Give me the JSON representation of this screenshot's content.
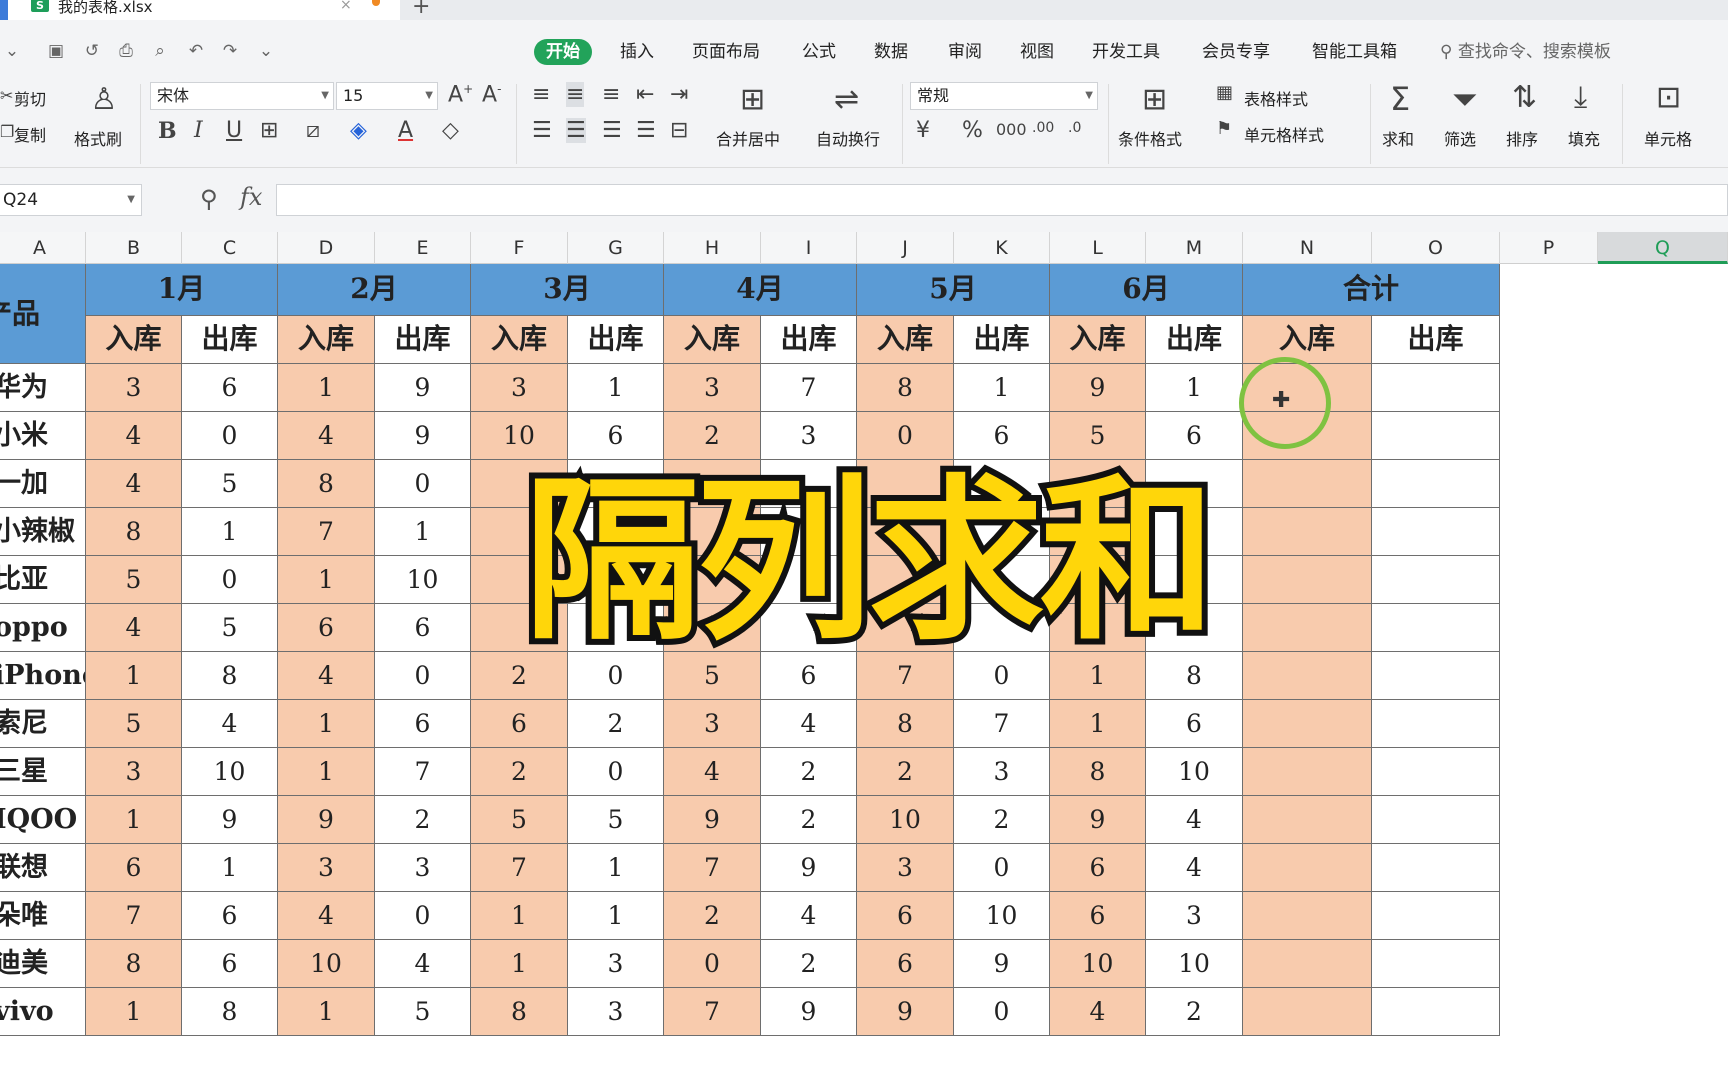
{
  "titlebar": {
    "file_name": "我的表格.xlsx",
    "close": "×",
    "new_tab": "+"
  },
  "menu": {
    "items": [
      "开始",
      "插入",
      "页面布局",
      "公式",
      "数据",
      "审阅",
      "视图",
      "开发工具",
      "会员专享",
      "智能工具箱"
    ],
    "search_placeholder": "查找命令、搜索模板"
  },
  "ribbon": {
    "cut": "剪切",
    "copy": "复制",
    "format_painter": "格式刷",
    "font_name": "宋体",
    "font_size": "15",
    "bold": "B",
    "italic": "I",
    "underline": "U",
    "merge_center": "合并居中",
    "wrap_text": "自动换行",
    "number_format": "常规",
    "conditional_format": "条件格式",
    "table_style": "表格样式",
    "cell_style": "单元格样式",
    "sum": "求和",
    "filter": "筛选",
    "sort": "排序",
    "fill": "填充",
    "cell": "单元格"
  },
  "formula_bar": {
    "cell_ref": "Q24",
    "fx": "fx",
    "value": ""
  },
  "columns": [
    "A",
    "B",
    "C",
    "D",
    "E",
    "F",
    "G",
    "H",
    "I",
    "J",
    "K",
    "L",
    "M",
    "N",
    "O",
    "P",
    "Q"
  ],
  "selected_column": "Q",
  "sheet": {
    "product_header": "产品",
    "months": [
      "1月",
      "2月",
      "3月",
      "4月",
      "5月",
      "6月"
    ],
    "total_header": "合计",
    "in_label": "入库",
    "out_label": "出库",
    "rows": [
      {
        "product": "华为",
        "values": [
          "3",
          "6",
          "1",
          "9",
          "3",
          "1",
          "3",
          "7",
          "8",
          "1",
          "9",
          "1"
        ]
      },
      {
        "product": "小米",
        "values": [
          "4",
          "0",
          "4",
          "9",
          "10",
          "6",
          "2",
          "3",
          "0",
          "6",
          "5",
          "6"
        ]
      },
      {
        "product": "一加",
        "values": [
          "4",
          "5",
          "8",
          "0",
          "",
          "",
          "",
          "",
          "",
          "",
          "",
          ""
        ]
      },
      {
        "product": "小辣椒",
        "values": [
          "8",
          "1",
          "7",
          "1",
          "",
          "",
          "",
          "",
          "",
          "",
          "",
          ""
        ]
      },
      {
        "product": "比亚",
        "values": [
          "5",
          "0",
          "1",
          "10",
          "",
          "",
          "",
          "",
          "",
          "",
          "",
          ""
        ]
      },
      {
        "product": "oppo",
        "values": [
          "4",
          "5",
          "6",
          "6",
          "",
          "",
          "",
          "",
          "",
          "",
          "",
          ""
        ]
      },
      {
        "product": "iPhone",
        "values": [
          "1",
          "8",
          "4",
          "0",
          "2",
          "0",
          "5",
          "6",
          "7",
          "0",
          "1",
          "8"
        ]
      },
      {
        "product": "索尼",
        "values": [
          "5",
          "4",
          "1",
          "6",
          "6",
          "2",
          "3",
          "4",
          "8",
          "7",
          "1",
          "6"
        ]
      },
      {
        "product": "三星",
        "values": [
          "3",
          "10",
          "1",
          "7",
          "2",
          "0",
          "4",
          "2",
          "2",
          "3",
          "8",
          "10"
        ]
      },
      {
        "product": "IQOO",
        "values": [
          "1",
          "9",
          "9",
          "2",
          "5",
          "5",
          "9",
          "2",
          "10",
          "2",
          "9",
          "4"
        ]
      },
      {
        "product": "联想",
        "values": [
          "6",
          "1",
          "3",
          "3",
          "7",
          "1",
          "7",
          "9",
          "3",
          "0",
          "6",
          "4"
        ]
      },
      {
        "product": "朵唯",
        "values": [
          "7",
          "6",
          "4",
          "0",
          "1",
          "1",
          "2",
          "4",
          "6",
          "10",
          "6",
          "3"
        ]
      },
      {
        "product": "迪美",
        "values": [
          "8",
          "6",
          "10",
          "4",
          "1",
          "3",
          "0",
          "2",
          "6",
          "9",
          "10",
          "10"
        ]
      },
      {
        "product": "vivo",
        "values": [
          "1",
          "8",
          "1",
          "5",
          "8",
          "3",
          "7",
          "9",
          "9",
          "0",
          "4",
          "2"
        ]
      }
    ]
  },
  "overlay_title": "隔列求和",
  "colors": {
    "header_blue": "#5b9bd5",
    "in_peach": "#f8cbad",
    "accent_green": "#22a35a",
    "title_yellow": "#ffd60a"
  }
}
